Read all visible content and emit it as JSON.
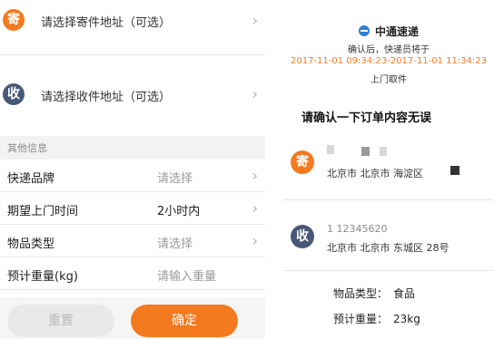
{
  "left": {
    "sender": {
      "badge": "寄",
      "text": "请选择寄件地址（可选）",
      "color": "#f47a20"
    },
    "receiver": {
      "badge": "收",
      "text": "请选择收件地址（可选）",
      "color": "#4a5878"
    },
    "section_label": "其他信息",
    "form": [
      {
        "label": "快递品牌",
        "value": "请选择",
        "placeholder": true,
        "chevron": true
      },
      {
        "label": "期望上门时间",
        "value": "2小时内",
        "placeholder": false,
        "chevron": true
      },
      {
        "label": "物品类型",
        "value": "请选择",
        "placeholder": true,
        "chevron": true
      },
      {
        "label": "预计重量(kg)",
        "value": "请输入重量",
        "placeholder": true,
        "chevron": false
      }
    ],
    "buttons": {
      "reset": "重置",
      "confirm": "确定"
    }
  },
  "right": {
    "carrier_name": "中通速递",
    "confirm_note": "确认后，快递员将于",
    "time_range": "2017-11-01 09:34:23-2017-11-01 11:34:23",
    "pickup": "上门取件",
    "title": "请确认一下订单内容无误",
    "sender": {
      "badge": "寄",
      "address": "北京市 北京市 海淀区"
    },
    "receiver": {
      "badge": "收",
      "phone": "1 12345620",
      "address": "北京市 北京市 东城区 28号"
    },
    "summary": {
      "type_label": "物品类型：",
      "type_value": "食品",
      "weight_label": "预计重量：",
      "weight_value": "23kg"
    }
  },
  "colors": {
    "accent": "#f47a20",
    "receiver_badge": "#4a5878"
  },
  "icons": [
    "chevron-right-icon",
    "carrier-logo-icon"
  ]
}
